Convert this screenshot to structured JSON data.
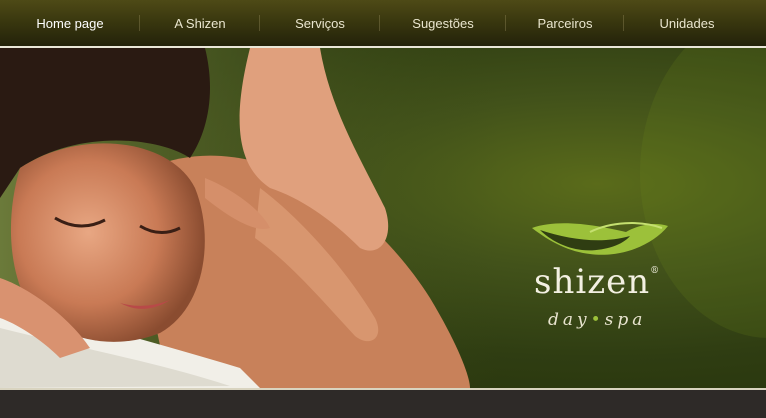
{
  "nav": {
    "items": [
      {
        "label": "Home page",
        "active": true
      },
      {
        "label": "A Shizen"
      },
      {
        "label": "Serviços"
      },
      {
        "label": "Sugestões"
      },
      {
        "label": "Parceiros"
      },
      {
        "label": "Unidades"
      }
    ]
  },
  "hero": {
    "logo": {
      "name": "shizen",
      "registered": "®",
      "sub_left": "day",
      "sub_dot": "•",
      "sub_right": "spa"
    }
  },
  "colors": {
    "nav_bg": "#3a380f",
    "hero_green": "#42521a",
    "accent_leaf": "#9cc13a"
  }
}
